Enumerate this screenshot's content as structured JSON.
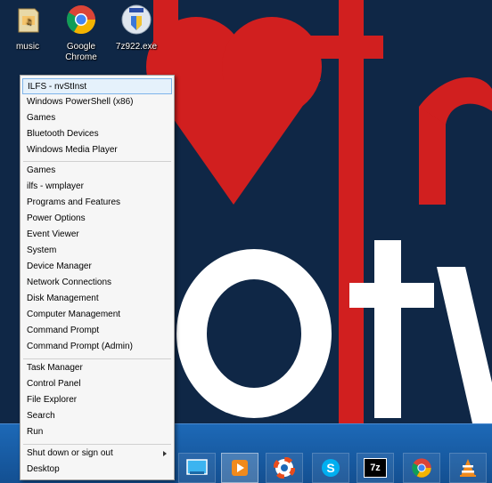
{
  "desktop_icons": [
    {
      "label": "music"
    },
    {
      "label": "Google Chrome"
    },
    {
      "label": "7z922.exe"
    }
  ],
  "menu": {
    "group1": [
      {
        "label": "ILFS - nvStInst"
      },
      {
        "label": "Windows PowerShell (x86)"
      },
      {
        "label": "Games"
      },
      {
        "label": "Bluetooth Devices"
      },
      {
        "label": "Windows Media Player"
      }
    ],
    "group2": [
      {
        "label": "Games"
      },
      {
        "label": "ilfs - wmplayer"
      },
      {
        "label": "Programs and Features"
      },
      {
        "label": "Power Options"
      },
      {
        "label": "Event Viewer"
      },
      {
        "label": "System"
      },
      {
        "label": "Device Manager"
      },
      {
        "label": "Network Connections"
      },
      {
        "label": "Disk Management"
      },
      {
        "label": "Computer Management"
      },
      {
        "label": "Command Prompt"
      },
      {
        "label": "Command Prompt (Admin)"
      }
    ],
    "group3": [
      {
        "label": "Task Manager"
      },
      {
        "label": "Control Panel"
      },
      {
        "label": "File Explorer"
      },
      {
        "label": "Search"
      },
      {
        "label": "Run"
      }
    ],
    "group4": [
      {
        "label": "Shut down or sign out"
      },
      {
        "label": "Desktop"
      }
    ]
  },
  "taskbar": {
    "items": [
      {
        "icon": "desktop-icon"
      },
      {
        "icon": "media-player-icon"
      },
      {
        "icon": "lifebuoy-icon"
      },
      {
        "icon": "skype-icon"
      },
      {
        "icon": "7zip-icon",
        "text": "7z"
      },
      {
        "icon": "chrome-icon"
      },
      {
        "icon": "vlc-icon"
      }
    ]
  },
  "colors": {
    "wallpaper": "#0f2746",
    "wallpaper_red": "#d11f1f",
    "menu_bg": "#f6f6f6",
    "highlight": "#e5f1fb",
    "taskbar": "#1d69b7"
  }
}
